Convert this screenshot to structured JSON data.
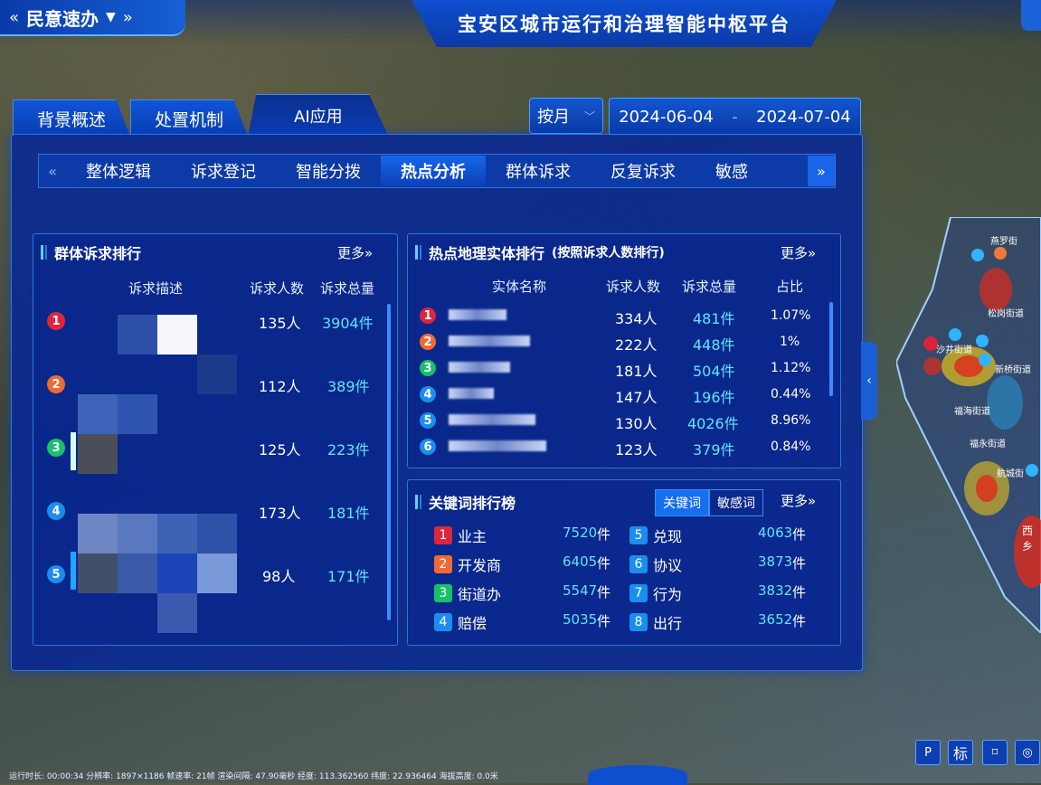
{
  "header": {
    "module": "民意速办",
    "title": "宝安区城市运行和治理智能中枢平台"
  },
  "main_tabs": [
    "背景概述",
    "处置机制",
    "AI应用"
  ],
  "filter": {
    "mode": "按月",
    "date_start": "2024-06-04",
    "date_sep": "-",
    "date_end": "2024-07-04"
  },
  "sub_tabs": [
    "整体逻辑",
    "诉求登记",
    "智能分拨",
    "热点分析",
    "群体诉求",
    "反复诉求",
    "敏感"
  ],
  "group_rank": {
    "title": "群体诉求排行",
    "more": "更多»",
    "cols": [
      "诉求描述",
      "诉求人数",
      "诉求总量"
    ],
    "rows": [
      {
        "rank": "1",
        "people": "135人",
        "total": "3904件"
      },
      {
        "rank": "2",
        "people": "112人",
        "total": "389件"
      },
      {
        "rank": "3",
        "people": "125人",
        "total": "223件"
      },
      {
        "rank": "4",
        "people": "173人",
        "total": "181件"
      },
      {
        "rank": "5",
        "people": "98人",
        "total": "171件"
      }
    ]
  },
  "geo_rank": {
    "title": "热点地理实体排行",
    "subtitle": "(按照诉求人数排行)",
    "more": "更多»",
    "cols": [
      "实体名称",
      "诉求人数",
      "诉求总量",
      "占比"
    ],
    "rows": [
      {
        "rank": "1",
        "people": "334人",
        "total": "481件",
        "pct": "1.07%"
      },
      {
        "rank": "2",
        "people": "222人",
        "total": "448件",
        "pct": "1%"
      },
      {
        "rank": "3",
        "people": "181人",
        "total": "504件",
        "pct": "1.12%"
      },
      {
        "rank": "4",
        "people": "147人",
        "total": "196件",
        "pct": "0.44%"
      },
      {
        "rank": "5",
        "people": "130人",
        "total": "4026件",
        "pct": "8.96%"
      },
      {
        "rank": "6",
        "people": "123人",
        "total": "379件",
        "pct": "0.84%"
      }
    ]
  },
  "keywords": {
    "title": "关键词排行榜",
    "tab_active": "关键词",
    "tab_other": "敏感词",
    "more": "更多»",
    "items": [
      {
        "rank": "1",
        "word": "业主",
        "count": "7520",
        "unit": "件"
      },
      {
        "rank": "2",
        "word": "开发商",
        "count": "6405",
        "unit": "件"
      },
      {
        "rank": "3",
        "word": "街道办",
        "count": "5547",
        "unit": "件"
      },
      {
        "rank": "4",
        "word": "赔偿",
        "count": "5035",
        "unit": "件"
      },
      {
        "rank": "5",
        "word": "兑现",
        "count": "4063",
        "unit": "件"
      },
      {
        "rank": "6",
        "word": "协议",
        "count": "3873",
        "unit": "件"
      },
      {
        "rank": "7",
        "word": "行为",
        "count": "3832",
        "unit": "件"
      },
      {
        "rank": "8",
        "word": "出行",
        "count": "3652",
        "unit": "件"
      }
    ]
  },
  "map_labels": [
    "燕罗街",
    "松岗街道",
    "沙井街道",
    "新桥街道",
    "福海街道",
    "福永街道",
    "航城街",
    "西乡"
  ],
  "tools": [
    "P",
    "标",
    "⌑",
    "◎"
  ],
  "status": "运行时长: 00:00:34  分辨率: 1897×1186  帧速率: 21帧  渲染间隔: 47.90毫秒  经度: 113.362560  纬度: 22.936464  海拔高度: 0.0米",
  "colors": {
    "rank1": "#e0243b",
    "rank2": "#ef6a32",
    "rank3": "#18c06a",
    "rank4": "#1b8df0",
    "rank5": "#1b8df0",
    "rank6": "#1b8df0",
    "accent": "#5fe6ff"
  }
}
